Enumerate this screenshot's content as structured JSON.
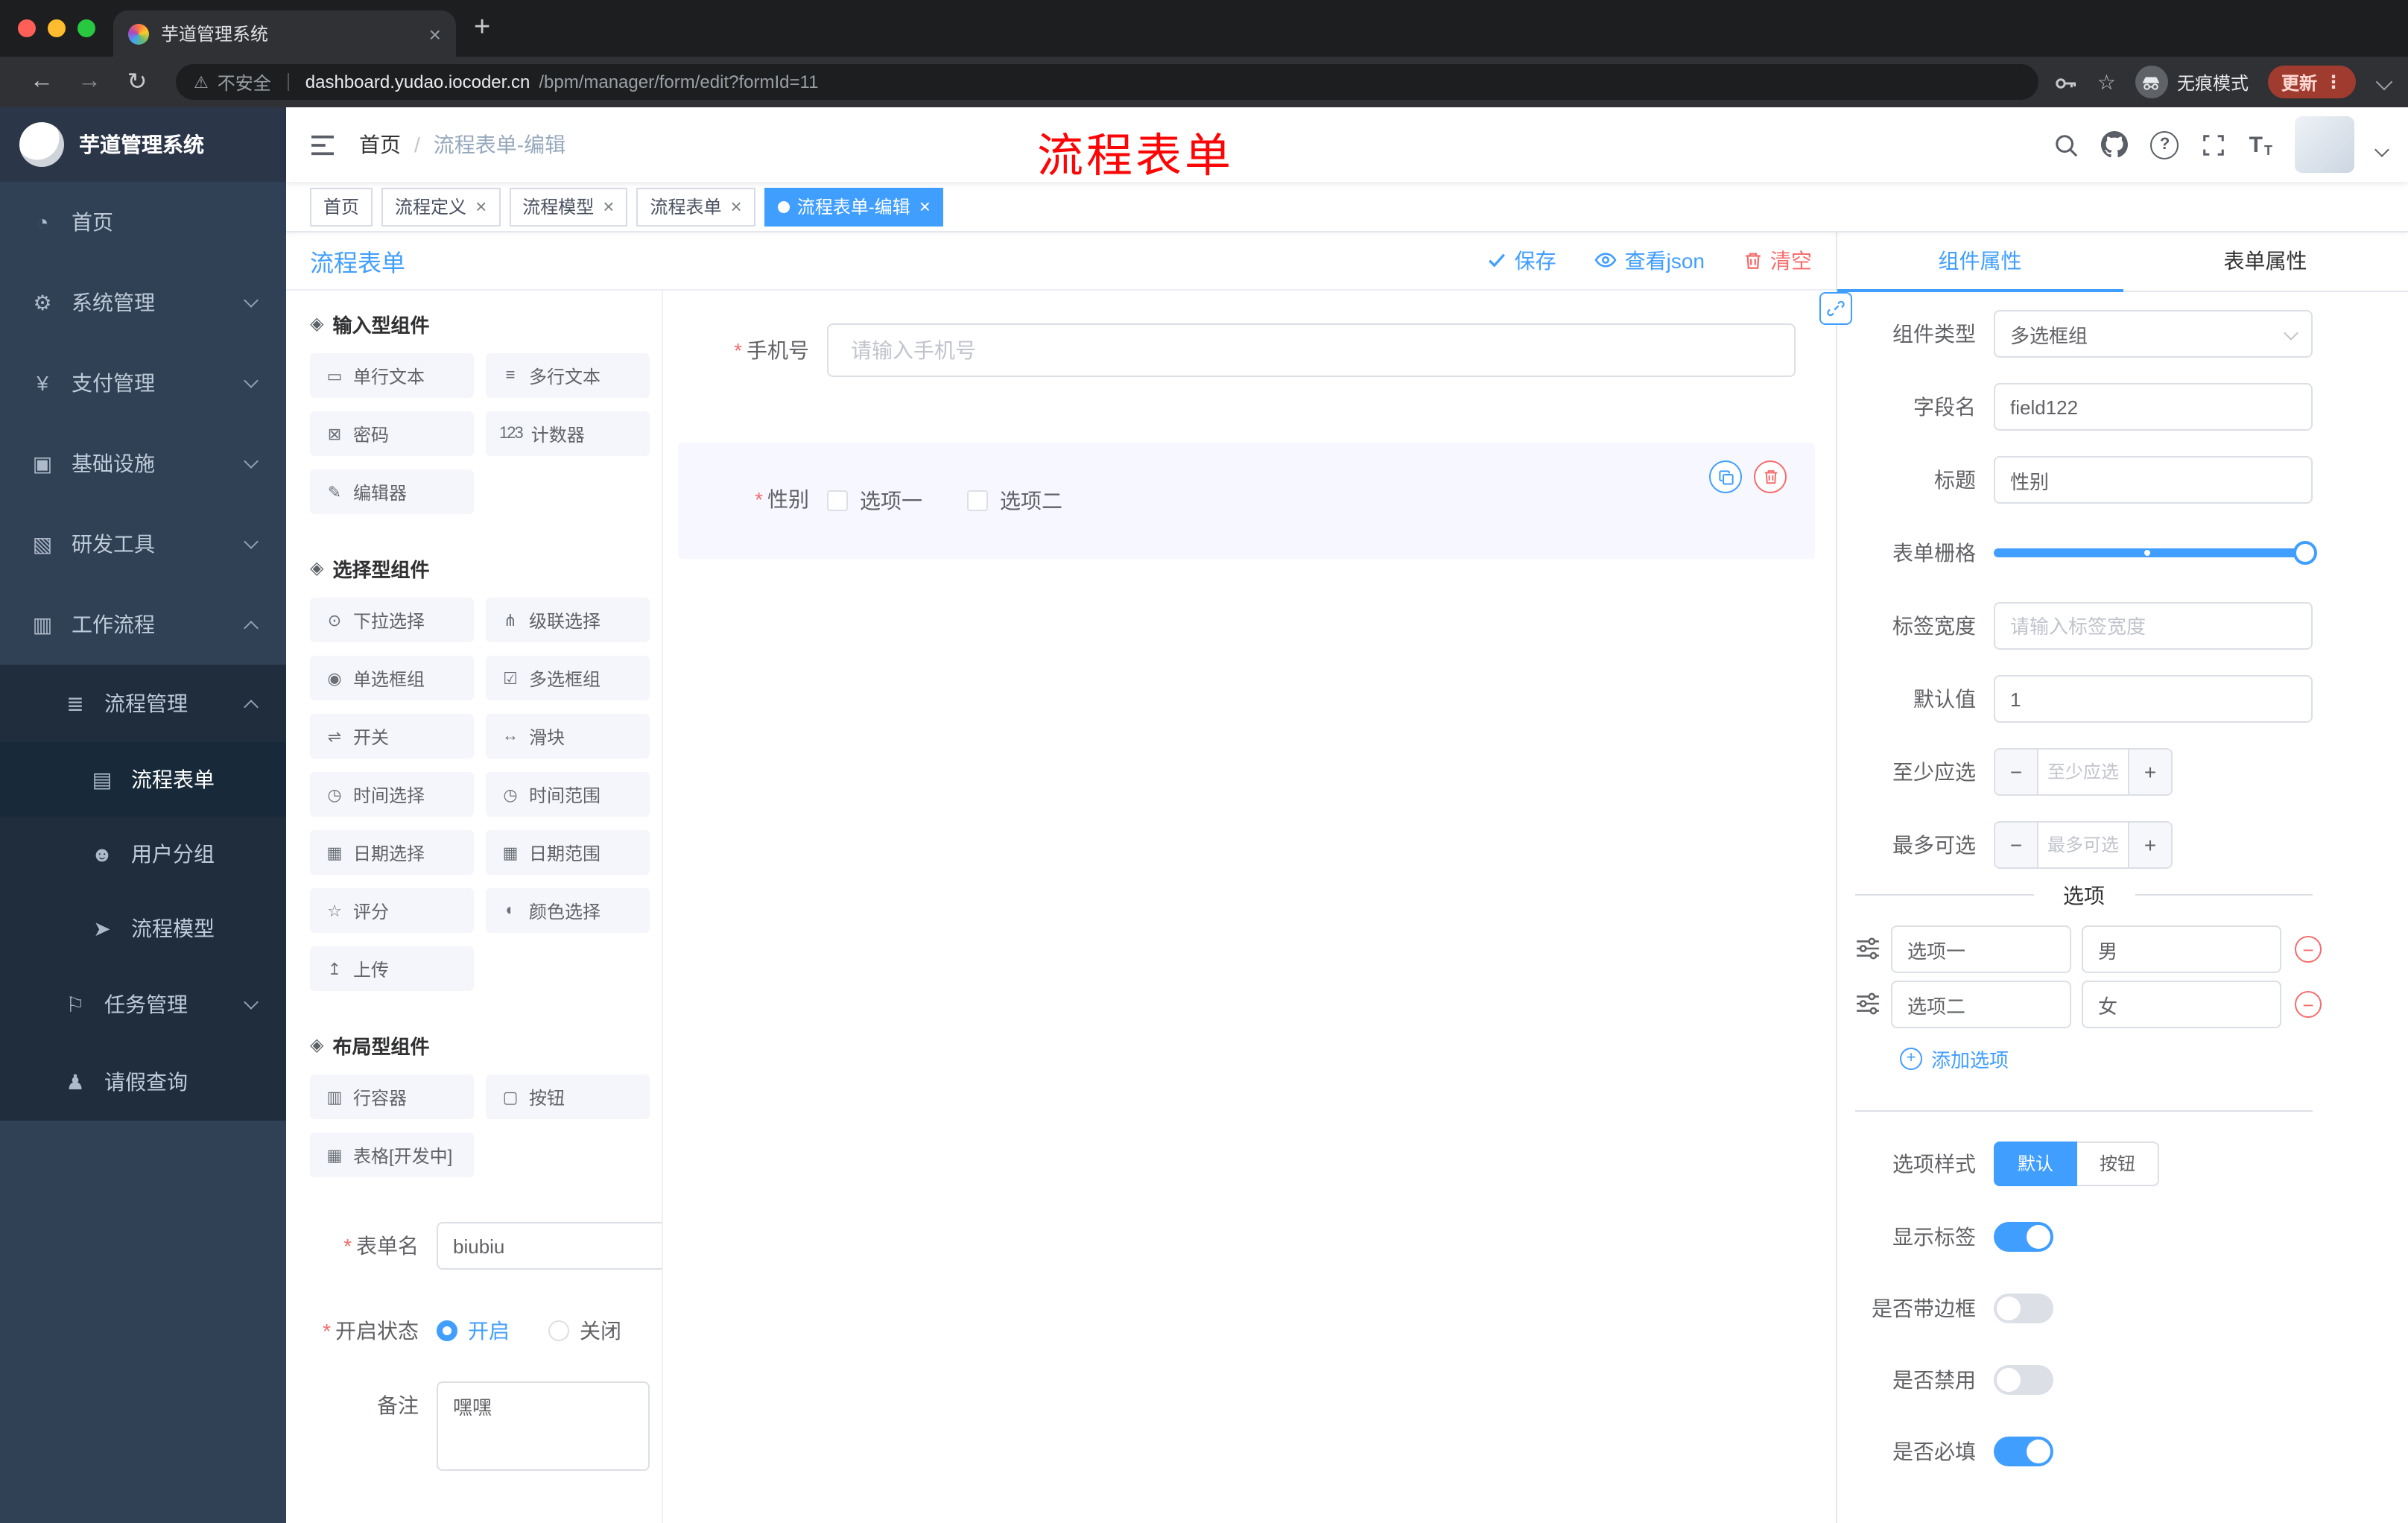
{
  "colors": {
    "accent": "#409eff",
    "danger": "#f56c6c",
    "annotation_red": "#fe0505",
    "sidebar_bg": "#304156",
    "submenu_bg": "#1f2d3d"
  },
  "icons": {
    "asterisk": "*",
    "close": "×",
    "plus": "+",
    "minus": "−",
    "dots": "⋮",
    "warning": "⚠",
    "star": "☆",
    "back": "←",
    "forward": "→",
    "reload": "↻",
    "slash": "/",
    "question": "?",
    "t_big": "T",
    "t_small": "T",
    "newtab": "+"
  },
  "browser": {
    "tab_title": "芋道管理系统",
    "security_label": "不安全",
    "url_host": "dashboard.yudao.iocoder.cn",
    "url_path": "/bpm/manager/form/edit?formId=11",
    "incognito_label": "无痕模式",
    "update_label": "更新"
  },
  "sidebar": {
    "logo_title": "芋道管理系统",
    "items": [
      {
        "icon": "◔",
        "label": "首页"
      },
      {
        "icon": "⚙",
        "label": "系统管理"
      },
      {
        "icon": "¥",
        "label": "支付管理"
      },
      {
        "icon": "▣",
        "label": "基础设施"
      },
      {
        "icon": "▧",
        "label": "研发工具"
      },
      {
        "icon": "▥",
        "label": "工作流程"
      },
      {
        "icon": "≣",
        "label": "流程管理"
      },
      {
        "icon": "▤",
        "label": "流程表单"
      },
      {
        "icon": "☻",
        "label": "用户分组"
      },
      {
        "icon": "➤",
        "label": "流程模型"
      },
      {
        "icon": "⚐",
        "label": "任务管理"
      },
      {
        "icon": "♟",
        "label": "请假查询"
      }
    ]
  },
  "navbar": {
    "breadcrumb_home": "首页",
    "breadcrumb_current": "流程表单-编辑",
    "annotation": "流程表单"
  },
  "tags": [
    {
      "label": "首页"
    },
    {
      "label": "流程定义"
    },
    {
      "label": "流程模型"
    },
    {
      "label": "流程表单"
    },
    {
      "label": "流程表单-编辑"
    }
  ],
  "designer": {
    "title": "流程表单",
    "save": "保存",
    "view_json": "查看json",
    "clear": "清空"
  },
  "palette": {
    "sections": [
      {
        "icon": "◈",
        "title": "输入型组件",
        "items": [
          {
            "icon": "▭",
            "label": "单行文本"
          },
          {
            "icon": "≡",
            "label": "多行文本"
          },
          {
            "icon": "⊠",
            "label": "密码"
          },
          {
            "icon": "123",
            "label": "计数器"
          },
          {
            "icon": "✎",
            "label": "编辑器"
          }
        ]
      },
      {
        "icon": "◈",
        "title": "选择型组件",
        "items": [
          {
            "icon": "⊙",
            "label": "下拉选择"
          },
          {
            "icon": "⋔",
            "label": "级联选择"
          },
          {
            "icon": "◉",
            "label": "单选框组"
          },
          {
            "icon": "☑",
            "label": "多选框组"
          },
          {
            "icon": "⇌",
            "label": "开关"
          },
          {
            "icon": "↔",
            "label": "滑块"
          },
          {
            "icon": "◷",
            "label": "时间选择"
          },
          {
            "icon": "◷",
            "label": "时间范围"
          },
          {
            "icon": "▦",
            "label": "日期选择"
          },
          {
            "icon": "▦",
            "label": "日期范围"
          },
          {
            "icon": "☆",
            "label": "评分"
          },
          {
            "icon": "◐",
            "label": "颜色选择"
          },
          {
            "icon": "↥",
            "label": "上传"
          }
        ]
      },
      {
        "icon": "◈",
        "title": "布局型组件",
        "items": [
          {
            "icon": "▥",
            "label": "行容器"
          },
          {
            "icon": "▢",
            "label": "按钮"
          },
          {
            "icon": "▦",
            "label": "表格[开发中]"
          }
        ]
      }
    ],
    "form": {
      "name_label": "表单名",
      "name_value": "biubiu",
      "status_label": "开启状态",
      "status_on": "开启",
      "status_off": "关闭",
      "remark_label": "备注",
      "remark_value": "嘿嘿"
    }
  },
  "canvas": {
    "phone_label": "手机号",
    "phone_placeholder": "请输入手机号",
    "gender_label": "性别",
    "gender_opt1": "选项一",
    "gender_opt2": "选项二"
  },
  "props": {
    "tab_component": "组件属性",
    "tab_form": "表单属性",
    "component_type_label": "组件类型",
    "component_type_value": "多选框组",
    "field_label": "字段名",
    "field_value": "field122",
    "title_label": "标题",
    "title_value": "性别",
    "grid_label": "表单栅格",
    "label_width_label": "标签宽度",
    "label_width_placeholder": "请输入标签宽度",
    "default_label": "默认值",
    "default_value": "1",
    "min_label": "至少应选",
    "min_placeholder": "至少应选",
    "max_label": "最多可选",
    "max_placeholder": "最多可选",
    "options_divider": "选项",
    "options": [
      {
        "name": "选项一",
        "value": "男"
      },
      {
        "name": "选项二",
        "value": "女"
      }
    ],
    "add_option": "添加选项",
    "style_label": "选项样式",
    "style_default": "默认",
    "style_button": "按钮",
    "switch_show_label": "显示标签",
    "switch_border_label": "是否带边框",
    "switch_disabled_label": "是否禁用",
    "switch_required_label": "是否必填"
  }
}
